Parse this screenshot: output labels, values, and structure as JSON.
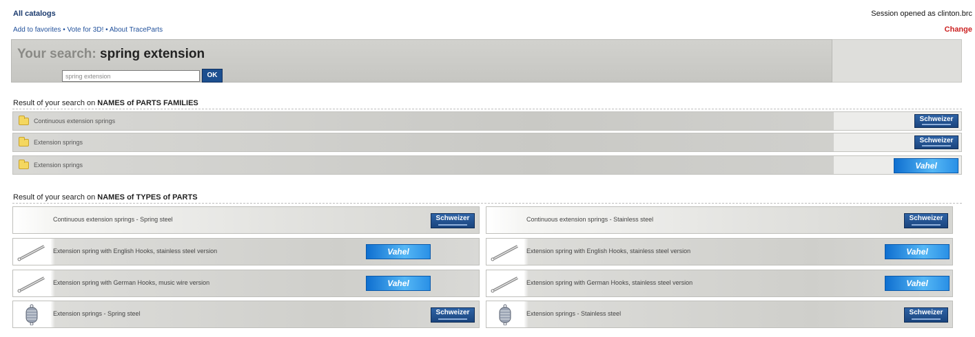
{
  "header": {
    "catalogs_link": "All catalogs",
    "session_text": "Session opened as clinton.brc",
    "links": [
      "Add to favorites",
      "Vote for 3D!",
      "About TraceParts"
    ],
    "link_separator": " • ",
    "change_link": "Change"
  },
  "search": {
    "label": "Your search:",
    "query": "spring extension",
    "input_value": "spring extension",
    "ok_label": "OK"
  },
  "families": {
    "title_prefix": "Result of your search on ",
    "title_bold": "NAMES of PARTS FAMILIES",
    "items": [
      {
        "name": "Continuous extension springs",
        "brand": "Schweizer"
      },
      {
        "name": "Extension springs",
        "brand": "Schweizer"
      },
      {
        "name": "Extension springs",
        "brand": "Vahel"
      }
    ]
  },
  "types": {
    "title_prefix": "Result of your search on ",
    "title_bold": "NAMES of TYPES of PARTS",
    "items": [
      {
        "name": "Continuous extension springs - Spring steel",
        "brand": "Schweizer",
        "thumb": "none"
      },
      {
        "name": "Continuous extension springs - Stainless steel",
        "brand": "Schweizer",
        "thumb": "none"
      },
      {
        "name": "Extension spring with English Hooks, stainless steel version",
        "brand": "Vahel",
        "thumb": "spring-rod-icon"
      },
      {
        "name": "Extension spring with English Hooks, stainless steel version",
        "brand": "Vahel",
        "thumb": "spring-rod-icon"
      },
      {
        "name": "Extension spring with German Hooks, music wire version",
        "brand": "Vahel",
        "thumb": "spring-rod-icon"
      },
      {
        "name": "Extension spring with German Hooks, stainless steel version",
        "brand": "Vahel",
        "thumb": "spring-rod-icon"
      },
      {
        "name": "Extension springs - Spring steel",
        "brand": "Schweizer",
        "thumb": "coil-spring-icon"
      },
      {
        "name": "Extension springs - Stainless steel",
        "brand": "Schweizer",
        "thumb": "coil-spring-icon"
      }
    ]
  },
  "colors": {
    "link_blue": "#1f4f9a",
    "change_red": "#cc2222",
    "schweizer_blue": "#1b457e",
    "vahel_blue": "#2a90e6"
  }
}
